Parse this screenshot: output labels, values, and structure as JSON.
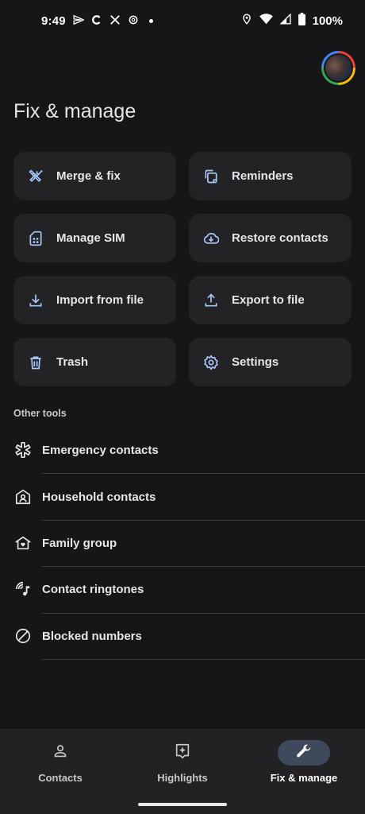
{
  "status_bar": {
    "time": "9:49",
    "notification_icons": [
      "send-icon",
      "c-icon",
      "x-icon",
      "threads-icon"
    ],
    "battery": "100%"
  },
  "header": {
    "title": "Fix & manage"
  },
  "cards": [
    {
      "label": "Merge & fix",
      "icon": "tools-icon"
    },
    {
      "label": "Reminders",
      "icon": "reminders-icon"
    },
    {
      "label": "Manage SIM",
      "icon": "sim-card-icon"
    },
    {
      "label": "Restore contacts",
      "icon": "cloud-download-icon"
    },
    {
      "label": "Import from file",
      "icon": "download-icon"
    },
    {
      "label": "Export to file",
      "icon": "upload-icon"
    },
    {
      "label": "Trash",
      "icon": "trash-icon"
    },
    {
      "label": "Settings",
      "icon": "gear-icon"
    }
  ],
  "other_tools": {
    "heading": "Other tools",
    "items": [
      {
        "label": "Emergency contacts",
        "icon": "emergency-icon"
      },
      {
        "label": "Household contacts",
        "icon": "household-icon"
      },
      {
        "label": "Family group",
        "icon": "family-home-icon"
      },
      {
        "label": "Contact ringtones",
        "icon": "ringtone-icon"
      },
      {
        "label": "Blocked numbers",
        "icon": "block-icon"
      }
    ]
  },
  "bottom_nav": {
    "items": [
      {
        "label": "Contacts",
        "icon": "person-icon",
        "active": false
      },
      {
        "label": "Highlights",
        "icon": "highlights-icon",
        "active": false
      },
      {
        "label": "Fix & manage",
        "icon": "wrench-icon",
        "active": true
      }
    ]
  },
  "colors": {
    "background": "#161618",
    "card": "#232325",
    "accent_icon": "#a8c7fa",
    "nav_active_pill": "#3e4a5c"
  }
}
